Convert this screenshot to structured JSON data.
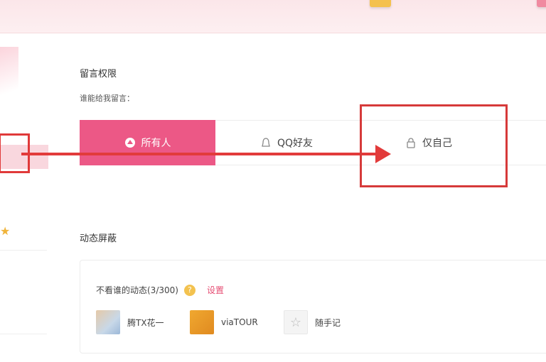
{
  "comment_permission": {
    "title": "留言权限",
    "subtitle": "谁能给我留言：",
    "options": [
      {
        "label": "所有人",
        "icon": "globe-icon",
        "selected": true
      },
      {
        "label": "QQ好友",
        "icon": "friends-icon",
        "selected": false
      },
      {
        "label": "仅自己",
        "icon": "lock-icon",
        "selected": false
      }
    ]
  },
  "feed_block": {
    "title": "动态屏蔽",
    "hidden_label": "不看谁的动态(3/300)",
    "help_icon": "?",
    "settings_link": "设置",
    "items": [
      {
        "name": "腾TX花一",
        "icon": "photo-avatar"
      },
      {
        "name": "viaTOUR",
        "icon": "orange-avatar"
      },
      {
        "name": "随手记",
        "icon": "star-avatar"
      }
    ]
  },
  "colors": {
    "accent": "#ec5886",
    "annotation": "#e23b3b",
    "link": "#e64d73"
  }
}
